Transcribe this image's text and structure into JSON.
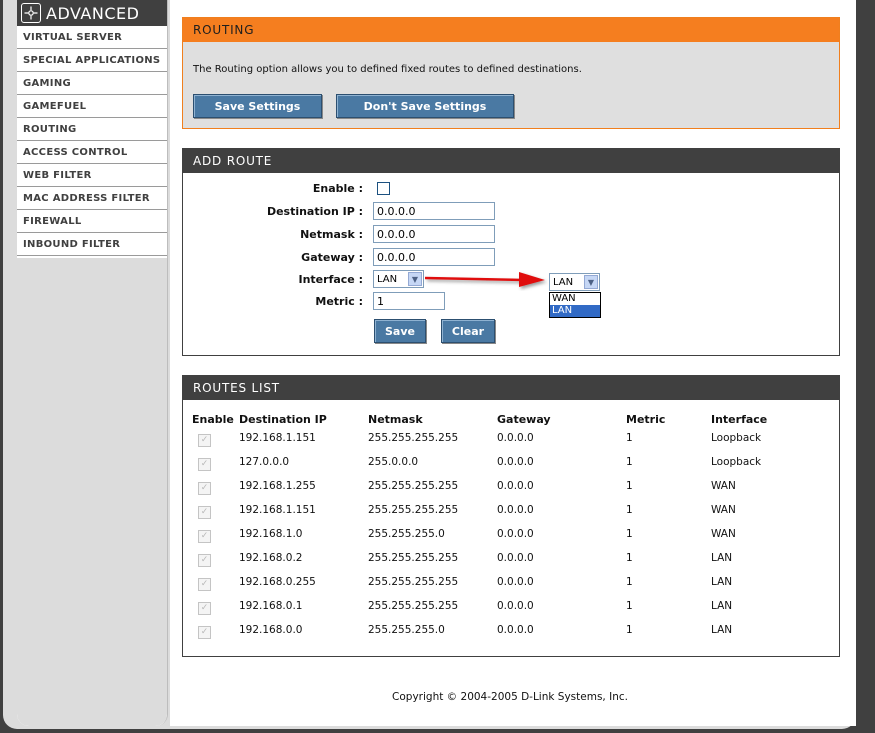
{
  "sidebar": {
    "header": "ADVANCED",
    "items": [
      "VIRTUAL SERVER",
      "SPECIAL APPLICATIONS",
      "GAMING",
      "GAMEFUEL",
      "ROUTING",
      "ACCESS CONTROL",
      "WEB FILTER",
      "MAC ADDRESS FILTER",
      "FIREWALL",
      "INBOUND FILTER"
    ]
  },
  "routing": {
    "title": "ROUTING",
    "description": "The Routing option allows you to defined fixed routes to defined destinations.",
    "save_label": "Save Settings",
    "dont_save_label": "Don't Save Settings"
  },
  "add_route": {
    "title": "ADD ROUTE",
    "enable_label": "Enable :",
    "dest_label": "Destination IP :",
    "dest_value": "0.0.0.0",
    "netmask_label": "Netmask :",
    "netmask_value": "0.0.0.0",
    "gateway_label": "Gateway :",
    "gateway_value": "0.0.0.0",
    "interface_label": "Interface :",
    "interface_value": "LAN",
    "metric_label": "Metric :",
    "metric_value": "1",
    "save_label": "Save",
    "clear_label": "Clear",
    "dropdown": {
      "selected": "LAN",
      "options": [
        "WAN",
        "LAN"
      ]
    }
  },
  "routes_list": {
    "title": "ROUTES LIST",
    "headers": [
      "Enable",
      "Destination IP",
      "Netmask",
      "Gateway",
      "Metric",
      "Interface"
    ],
    "rows": [
      {
        "dest": "192.168.1.151",
        "mask": "255.255.255.255",
        "gw": "0.0.0.0",
        "metric": "1",
        "iface": "Loopback"
      },
      {
        "dest": "127.0.0.0",
        "mask": "255.0.0.0",
        "gw": "0.0.0.0",
        "metric": "1",
        "iface": "Loopback"
      },
      {
        "dest": "192.168.1.255",
        "mask": "255.255.255.255",
        "gw": "0.0.0.0",
        "metric": "1",
        "iface": "WAN"
      },
      {
        "dest": "192.168.1.151",
        "mask": "255.255.255.255",
        "gw": "0.0.0.0",
        "metric": "1",
        "iface": "WAN"
      },
      {
        "dest": "192.168.1.0",
        "mask": "255.255.255.0",
        "gw": "0.0.0.0",
        "metric": "1",
        "iface": "WAN"
      },
      {
        "dest": "192.168.0.2",
        "mask": "255.255.255.255",
        "gw": "0.0.0.0",
        "metric": "1",
        "iface": "LAN"
      },
      {
        "dest": "192.168.0.255",
        "mask": "255.255.255.255",
        "gw": "0.0.0.0",
        "metric": "1",
        "iface": "LAN"
      },
      {
        "dest": "192.168.0.1",
        "mask": "255.255.255.255",
        "gw": "0.0.0.0",
        "metric": "1",
        "iface": "LAN"
      },
      {
        "dest": "192.168.0.0",
        "mask": "255.255.255.0",
        "gw": "0.0.0.0",
        "metric": "1",
        "iface": "LAN"
      }
    ]
  },
  "footer": {
    "copyright": "Copyright © 2004-2005 D-Link Systems, Inc."
  },
  "colors": {
    "accent_orange": "#f57e1f",
    "button_blue": "#4a79a3",
    "header_dark": "#404040",
    "arrow_red": "#e01010"
  }
}
